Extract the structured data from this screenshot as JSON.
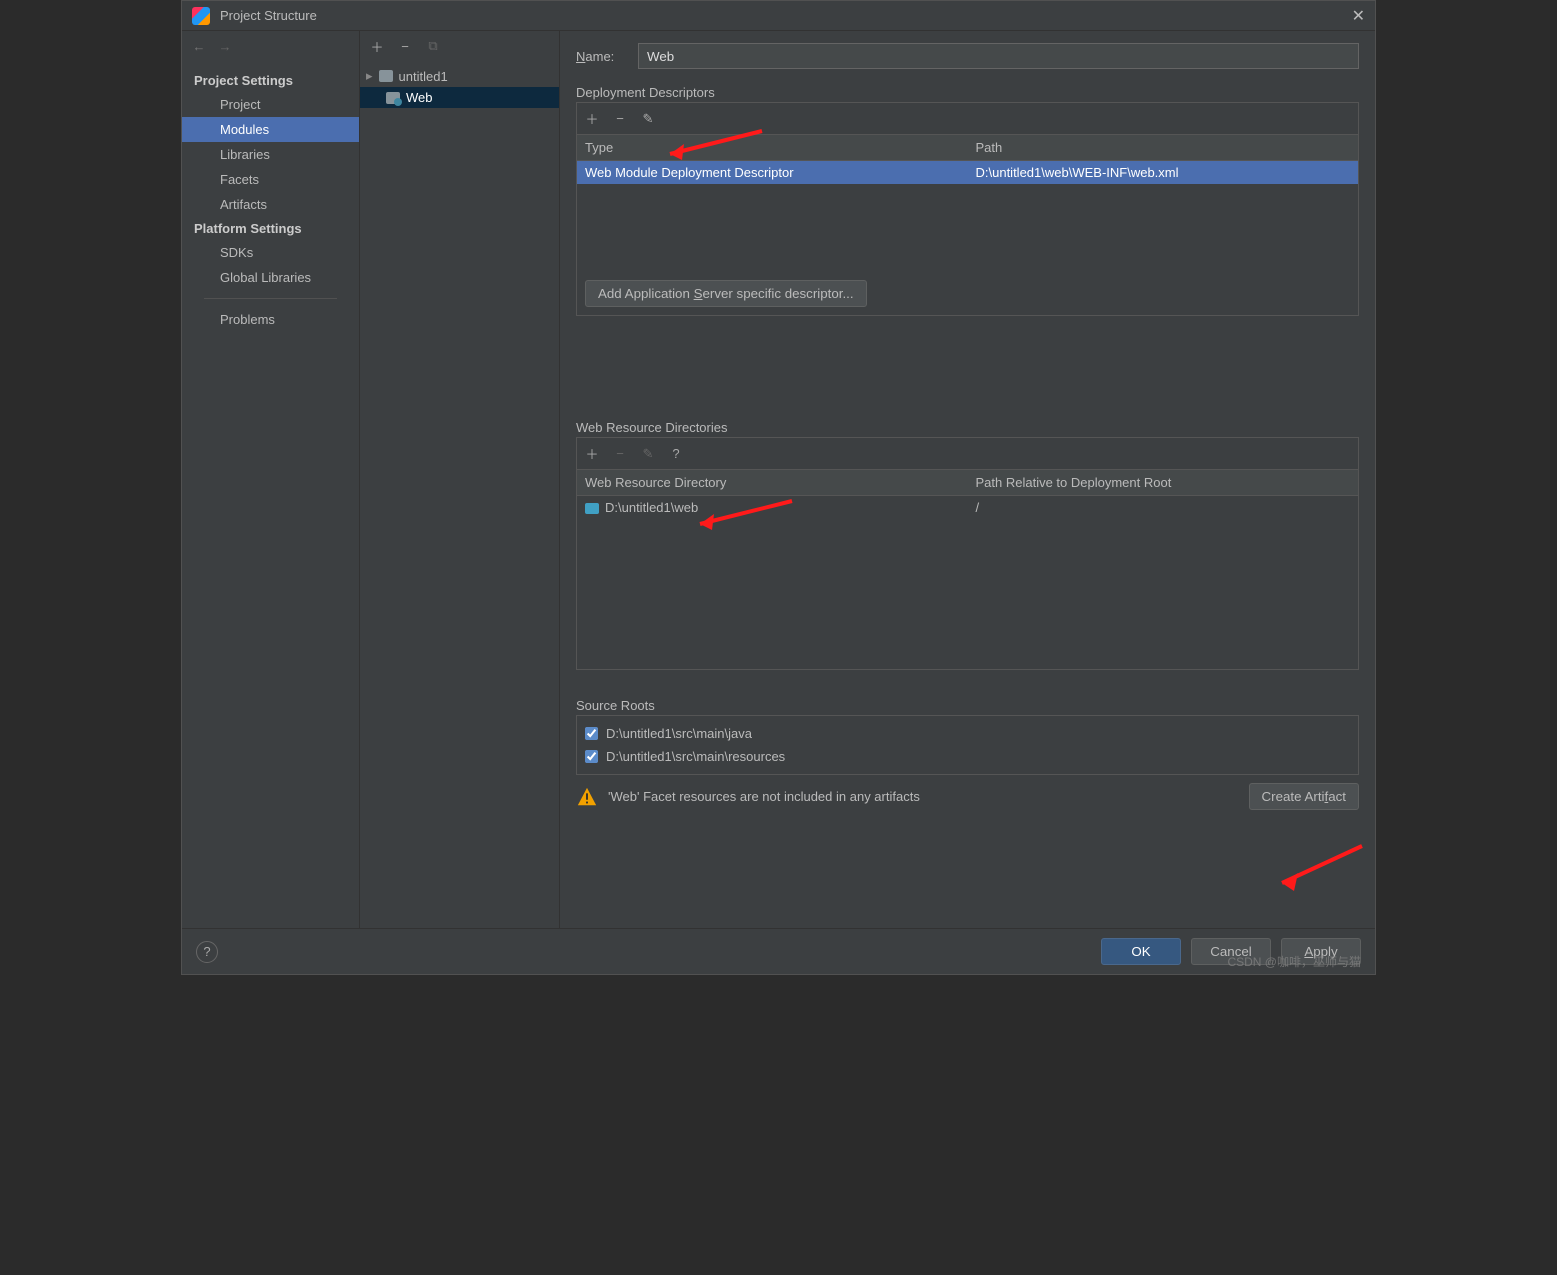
{
  "window": {
    "title": "Project Structure"
  },
  "sidebar": {
    "headings": {
      "project": "Project Settings",
      "platform": "Platform Settings"
    },
    "items": {
      "project": "Project",
      "modules": "Modules",
      "libraries": "Libraries",
      "facets": "Facets",
      "artifacts": "Artifacts",
      "sdks": "SDKs",
      "globalLibs": "Global Libraries",
      "problems": "Problems"
    }
  },
  "tree": {
    "root": "untitled1",
    "child": "Web"
  },
  "name": {
    "label": "Name:",
    "value": "Web"
  },
  "deployment": {
    "title": "Deployment Descriptors",
    "cols": {
      "type": "Type",
      "path": "Path"
    },
    "row": {
      "type": "Web Module Deployment Descriptor",
      "path": "D:\\untitled1\\web\\WEB-INF\\web.xml"
    },
    "addBtnPrefix": "Add Application ",
    "addBtnS": "S",
    "addBtnSuffix": "erver specific descriptor..."
  },
  "webres": {
    "title": "Web Resource Directories",
    "cols": {
      "dir": "Web Resource Directory",
      "path": "Path Relative to Deployment Root"
    },
    "row": {
      "dir": "D:\\untitled1\\web",
      "path": "/"
    }
  },
  "sourceRoots": {
    "title": "Source Roots",
    "items": [
      "D:\\untitled1\\src\\main\\java",
      "D:\\untitled1\\src\\main\\resources"
    ]
  },
  "warn": {
    "text": "'Web' Facet resources are not included in any artifacts"
  },
  "createArtifact": {
    "pre": "Create Arti",
    "f": "f",
    "post": "act"
  },
  "footer": {
    "ok": "OK",
    "cancel": "Cancel",
    "applyA": "A",
    "applyRest": "pply"
  },
  "watermark": "CSDN @咖啡，巫师与猫"
}
